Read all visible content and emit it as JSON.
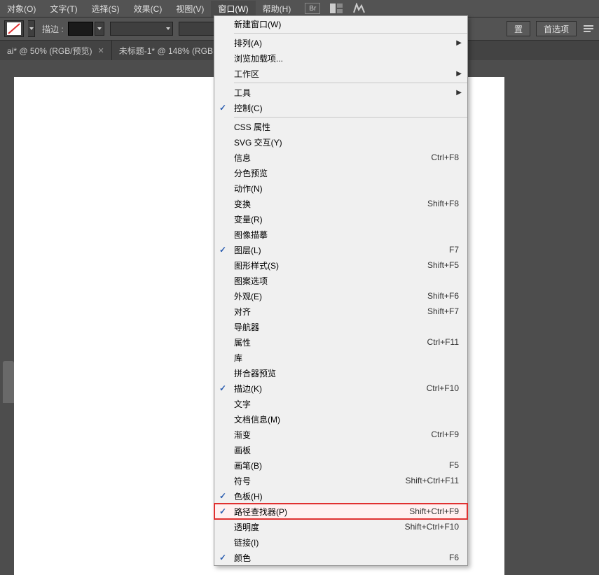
{
  "menubar": {
    "items": [
      {
        "label": "对象(O)"
      },
      {
        "label": "文字(T)"
      },
      {
        "label": "选择(S)"
      },
      {
        "label": "效果(C)"
      },
      {
        "label": "视图(V)"
      },
      {
        "label": "窗口(W)",
        "active": true
      },
      {
        "label": "帮助(H)"
      }
    ]
  },
  "topicons": {
    "br": "Br"
  },
  "toolbar": {
    "stroke_label": "描边 :"
  },
  "right_buttons": {
    "setup": "置",
    "prefs": "首选项"
  },
  "tabs": [
    {
      "label": "ai* @ 50% (RGB/预览)"
    },
    {
      "label": "未标题-1* @ 148% (RGB"
    }
  ],
  "menu": {
    "groups": [
      [
        {
          "label": "新建窗口(W)"
        }
      ],
      [
        {
          "label": "排列(A)",
          "submenu": true
        },
        {
          "label": "浏览加载项..."
        },
        {
          "label": "工作区",
          "submenu": true
        }
      ],
      [
        {
          "label": "工具",
          "submenu": true
        },
        {
          "label": "控制(C)",
          "checked": true
        }
      ],
      [
        {
          "label": "CSS 属性"
        },
        {
          "label": "SVG 交互(Y)"
        },
        {
          "label": "信息",
          "shortcut": "Ctrl+F8"
        },
        {
          "label": "分色预览"
        },
        {
          "label": "动作(N)"
        },
        {
          "label": "变换",
          "shortcut": "Shift+F8"
        },
        {
          "label": "变量(R)"
        },
        {
          "label": "图像描摹"
        },
        {
          "label": "图层(L)",
          "checked": true,
          "shortcut": "F7"
        },
        {
          "label": "图形样式(S)",
          "shortcut": "Shift+F5"
        },
        {
          "label": "图案选项"
        },
        {
          "label": "外观(E)",
          "shortcut": "Shift+F6"
        },
        {
          "label": "对齐",
          "shortcut": "Shift+F7"
        },
        {
          "label": "导航器"
        },
        {
          "label": "属性",
          "shortcut": "Ctrl+F11"
        },
        {
          "label": "库"
        },
        {
          "label": "拼合器预览"
        },
        {
          "label": "描边(K)",
          "checked": true,
          "shortcut": "Ctrl+F10"
        },
        {
          "label": "文字"
        },
        {
          "label": "文档信息(M)"
        },
        {
          "label": "渐变",
          "shortcut": "Ctrl+F9"
        },
        {
          "label": "画板"
        },
        {
          "label": "画笔(B)",
          "shortcut": "F5"
        },
        {
          "label": "符号",
          "shortcut": "Shift+Ctrl+F11"
        },
        {
          "label": "色板(H)",
          "checked": true
        },
        {
          "label": "路径查找器(P)",
          "checked": true,
          "shortcut": "Shift+Ctrl+F9",
          "highlight": true
        },
        {
          "label": "透明度",
          "shortcut": "Shift+Ctrl+F10"
        },
        {
          "label": "链接(I)"
        },
        {
          "label": "颜色",
          "checked": true,
          "shortcut": "F6"
        }
      ]
    ]
  }
}
